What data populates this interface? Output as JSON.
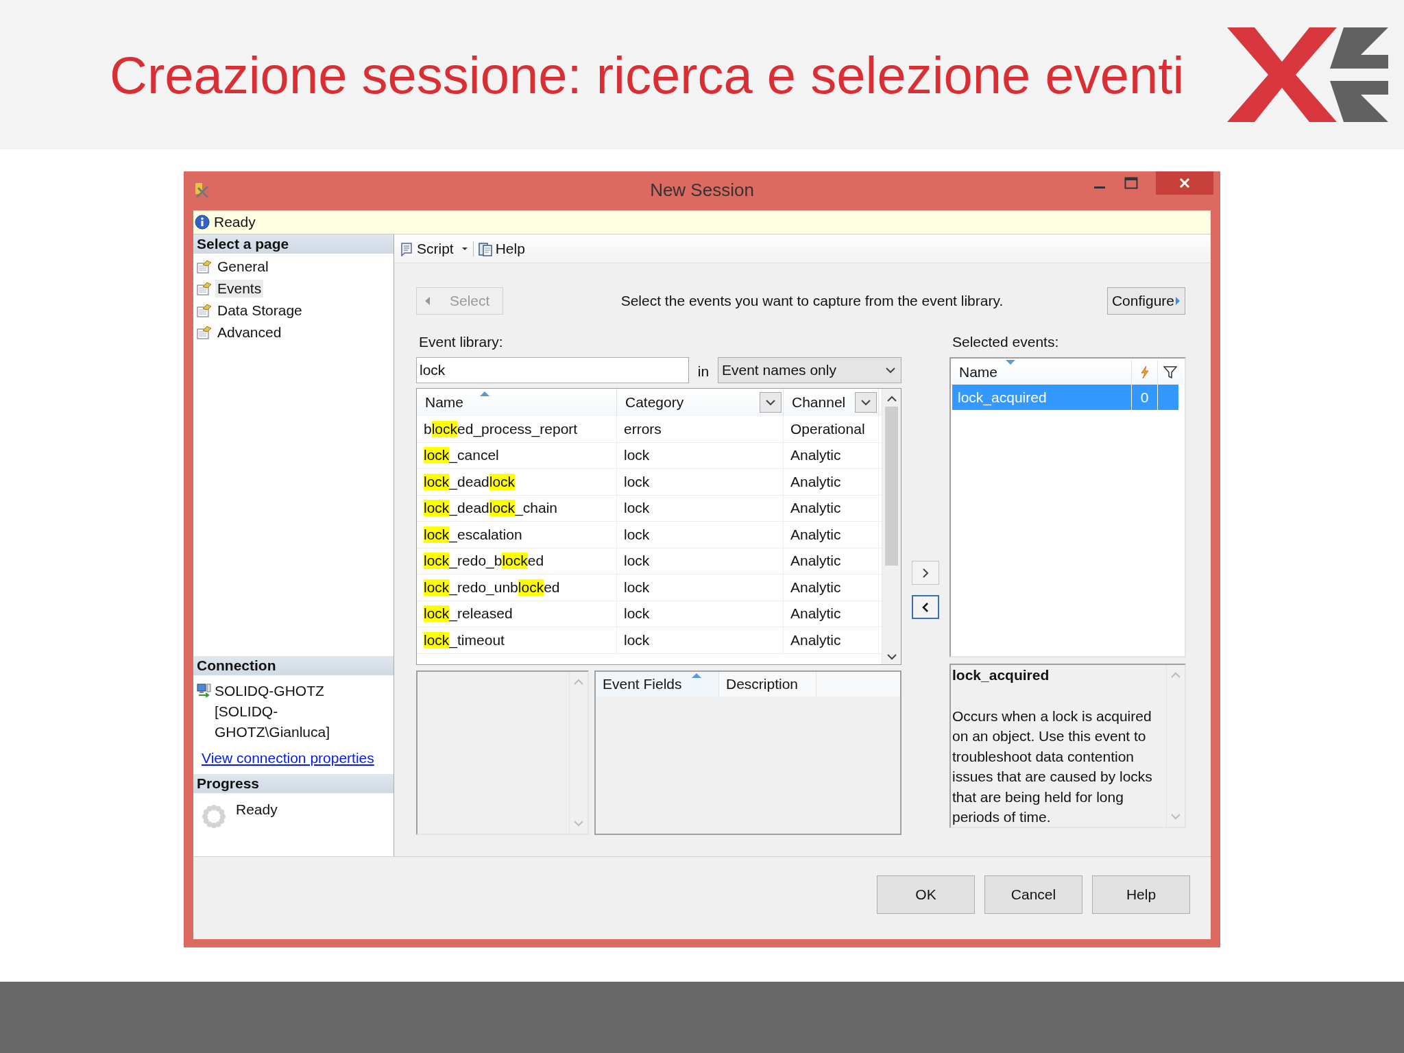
{
  "slide": {
    "title": "Creazione sessione: ricerca e selezione eventi"
  },
  "window": {
    "title": "New Session"
  },
  "info_bar": {
    "text": "Ready"
  },
  "sidebar": {
    "heading": "Select a page",
    "items": [
      {
        "label": "General",
        "selected": false
      },
      {
        "label": "Events",
        "selected": true
      },
      {
        "label": "Data Storage",
        "selected": false
      },
      {
        "label": "Advanced",
        "selected": false
      }
    ]
  },
  "connection": {
    "heading": "Connection",
    "server": "SOLIDQ-GHOTZ [SOLIDQ-GHOTZ\\Gianluca]",
    "link": "View connection properties"
  },
  "progress": {
    "heading": "Progress",
    "status": "Ready"
  },
  "toolbar": [
    {
      "label": "Script",
      "kind": "dropdown"
    },
    {
      "label": "Help",
      "kind": "button"
    }
  ],
  "select_button": {
    "label": "Select",
    "disabled": true
  },
  "instruction": "Select the events you want to capture from the event library.",
  "configure_button": {
    "label": "Configure"
  },
  "event_library": {
    "label": "Event library:",
    "search": "lock",
    "in_label": "in",
    "scope": "Event names only",
    "columns": [
      "Name",
      "Category",
      "Channel"
    ],
    "rows": [
      {
        "name": [
          {
            "text": "b",
            "highlight": false
          },
          {
            "text": "lock",
            "highlight": true
          },
          {
            "text": "ed_process_report",
            "highlight": false
          }
        ],
        "category": "errors",
        "channel": "Operational"
      },
      {
        "name": [
          {
            "text": "lock",
            "highlight": true
          },
          {
            "text": "_cancel",
            "highlight": false
          }
        ],
        "category": "lock",
        "channel": "Analytic"
      },
      {
        "name": [
          {
            "text": "lock",
            "highlight": true
          },
          {
            "text": "_dead",
            "highlight": false
          },
          {
            "text": "lock",
            "highlight": true
          }
        ],
        "category": "lock",
        "channel": "Analytic"
      },
      {
        "name": [
          {
            "text": "lock",
            "highlight": true
          },
          {
            "text": "_dead",
            "highlight": false
          },
          {
            "text": "lock",
            "highlight": true
          },
          {
            "text": "_chain",
            "highlight": false
          }
        ],
        "category": "lock",
        "channel": "Analytic"
      },
      {
        "name": [
          {
            "text": "lock",
            "highlight": true
          },
          {
            "text": "_escalation",
            "highlight": false
          }
        ],
        "category": "lock",
        "channel": "Analytic"
      },
      {
        "name": [
          {
            "text": "lock",
            "highlight": true
          },
          {
            "text": "_redo_b",
            "highlight": false
          },
          {
            "text": "lock",
            "highlight": true
          },
          {
            "text": "ed",
            "highlight": false
          }
        ],
        "category": "lock",
        "channel": "Analytic"
      },
      {
        "name": [
          {
            "text": "lock",
            "highlight": true
          },
          {
            "text": "_redo_unb",
            "highlight": false
          },
          {
            "text": "lock",
            "highlight": true
          },
          {
            "text": "ed",
            "highlight": false
          }
        ],
        "category": "lock",
        "channel": "Analytic"
      },
      {
        "name": [
          {
            "text": "lock",
            "highlight": true
          },
          {
            "text": "_released",
            "highlight": false
          }
        ],
        "category": "lock",
        "channel": "Analytic"
      },
      {
        "name": [
          {
            "text": "lock",
            "highlight": true
          },
          {
            "text": "_timeout",
            "highlight": false
          }
        ],
        "category": "lock",
        "channel": "Analytic"
      }
    ]
  },
  "selected_events": {
    "label": "Selected events:",
    "columns": [
      "Name"
    ],
    "rows": [
      {
        "name": "lock_acquired",
        "count": "0",
        "selected": true
      }
    ]
  },
  "detail": {
    "columns": [
      "Event Fields",
      "Description"
    ]
  },
  "description": {
    "title": "lock_acquired",
    "text": "Occurs when a lock is acquired on an object. Use this event to troubleshoot data contention issues that are caused by locks that are being held for long periods of time."
  },
  "buttons": [
    "OK",
    "Cancel",
    "Help"
  ]
}
